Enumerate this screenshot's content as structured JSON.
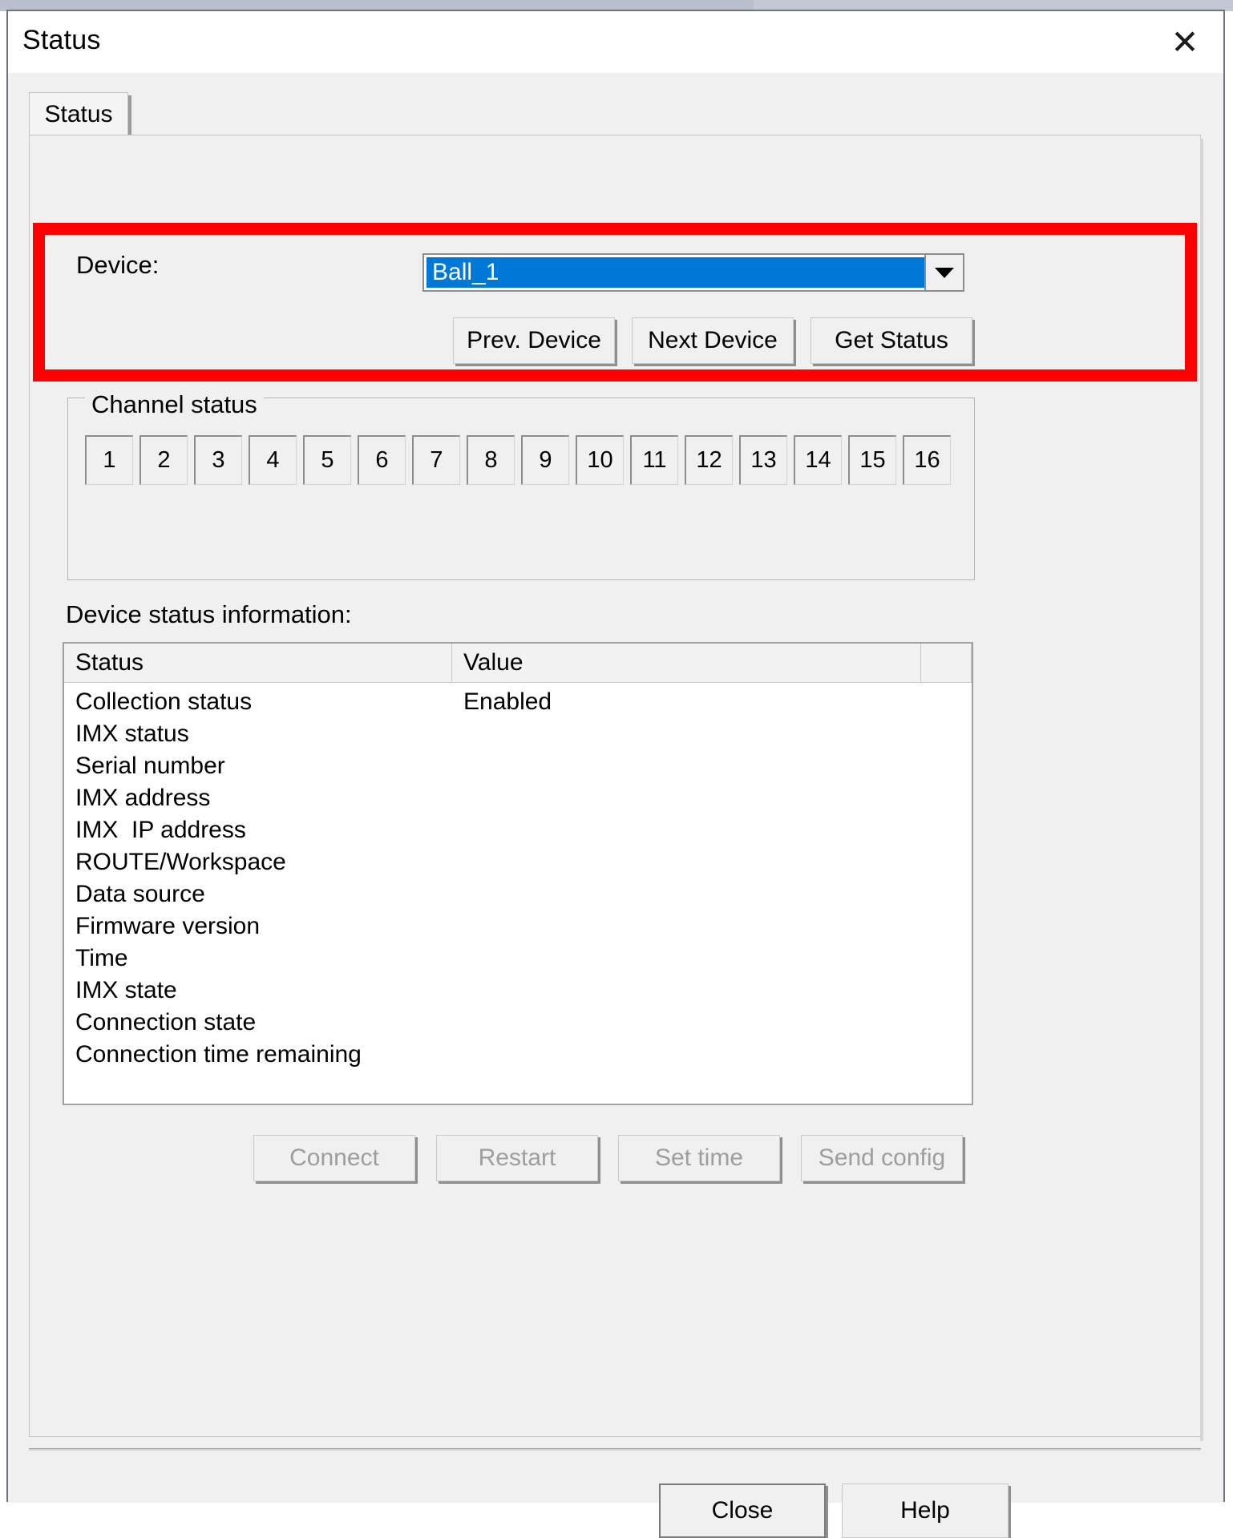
{
  "window": {
    "title": "Status",
    "close_icon": "close-icon"
  },
  "tabs": [
    {
      "label": "Status"
    }
  ],
  "device": {
    "label": "Device:",
    "selected": "Ball_1",
    "dropdown_icon": "chevron-down-icon",
    "buttons": {
      "prev": "Prev. Device",
      "next": "Next Device",
      "get_status": "Get Status"
    },
    "highlight_color": "#fe0000",
    "selection_color": "#0078d7"
  },
  "channel_status": {
    "title": "Channel status",
    "channels": [
      "1",
      "2",
      "3",
      "4",
      "5",
      "6",
      "7",
      "8",
      "9",
      "10",
      "11",
      "12",
      "13",
      "14",
      "15",
      "16"
    ]
  },
  "device_status": {
    "label": "Device status information:",
    "columns": [
      "Status",
      "Value",
      ""
    ],
    "rows": [
      {
        "status": "Collection status",
        "value": "Enabled"
      },
      {
        "status": "IMX status",
        "value": ""
      },
      {
        "status": "Serial number",
        "value": ""
      },
      {
        "status": "IMX address",
        "value": ""
      },
      {
        "status": "IMX  IP address",
        "value": ""
      },
      {
        "status": "ROUTE/Workspace",
        "value": ""
      },
      {
        "status": "Data source",
        "value": ""
      },
      {
        "status": "Firmware version",
        "value": ""
      },
      {
        "status": "Time",
        "value": ""
      },
      {
        "status": "IMX state",
        "value": ""
      },
      {
        "status": "Connection state",
        "value": ""
      },
      {
        "status": "Connection time remaining",
        "value": ""
      }
    ]
  },
  "actions": {
    "connect": "Connect",
    "restart": "Restart",
    "set_time": "Set time",
    "send_config": "Send config"
  },
  "footer": {
    "close": "Close",
    "help": "Help"
  }
}
